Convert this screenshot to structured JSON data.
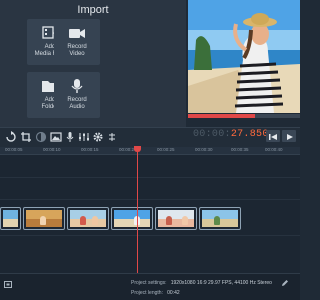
{
  "import_panel": {
    "title": "Import",
    "tiles": [
      {
        "line1": "Add",
        "line2": "Media Files",
        "icon": "media-files-icon"
      },
      {
        "line1": "Record",
        "line2": "Video",
        "icon": "video-camera-icon"
      },
      {
        "line1": "Add",
        "line2": "Folder",
        "icon": "folder-icon"
      },
      {
        "line1": "Record",
        "line2": "Audio",
        "icon": "microphone-icon"
      }
    ]
  },
  "player": {
    "timecode_main": "00:00:",
    "timecode_active": "27.850",
    "progress_fraction": 0.6
  },
  "ruler": {
    "ticks": [
      "00:00:05",
      "00:00:10",
      "00:00:15",
      "00:00:20",
      "00:00:25",
      "00:00:30",
      "00:00:35",
      "00:00:40",
      "00:00:45"
    ]
  },
  "status": {
    "settings_label": "Project settings:",
    "settings_value": "1920x1080 16:9 29.97 FPS, 44100 Hz Stereo",
    "length_label": "Project length:",
    "length_value": "00:42"
  },
  "colors": {
    "accent": "#e04848",
    "timecode_active": "#ff6a3d",
    "panel": "#2a3542",
    "tile": "#364352"
  }
}
